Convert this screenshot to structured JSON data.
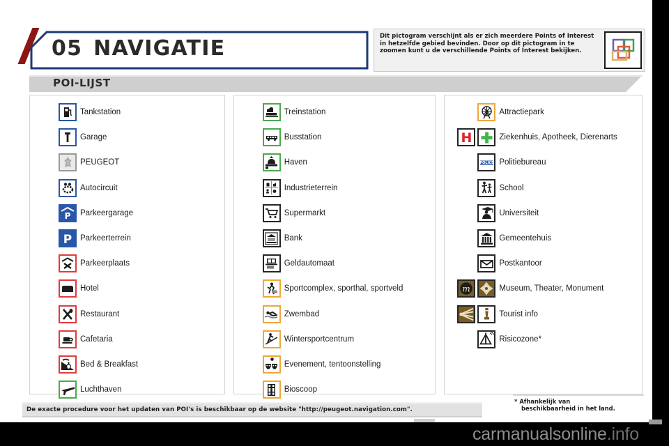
{
  "page": {
    "chapter_number": "05",
    "chapter_title": "NAVIGATIE",
    "section_label": "POI-LIJST",
    "watermark": "carmanualsonline",
    "watermark_suffix": ".info"
  },
  "note": {
    "text": "Dit pictogram verschijnt als er zich meerdere Points of Interest in hetzelfde gebied bevinden. Door op dit pictogram in te zoomen kunt u de verschillende Points of Interest bekijken.",
    "icon": "multiple-poi-icon"
  },
  "footer": {
    "update_note": "De exacte procedure voor het updaten van POI's is beschikbaar op de website \"http://peugeot.navigation.com\".",
    "footnote_marker": "*",
    "footnote_line1": "Afhankelijk van",
    "footnote_line2": "beschikbaarheid in het land."
  },
  "columns": [
    {
      "id": "column-1",
      "items": [
        {
          "label": "Tankstation",
          "icons": [
            "fuel-pump-icon"
          ],
          "border": "blue"
        },
        {
          "label": "Garage",
          "icons": [
            "wrench-icon"
          ],
          "border": "blue"
        },
        {
          "label": "PEUGEOT",
          "icons": [
            "peugeot-lion-icon"
          ],
          "border": "grey"
        },
        {
          "label": "Autocircuit",
          "icons": [
            "race-track-icon"
          ],
          "border": "blue"
        },
        {
          "label": "Parkeergarage",
          "icons": [
            "parking-garage-icon"
          ],
          "border": "blue"
        },
        {
          "label": "Parkeerterrein",
          "icons": [
            "parking-lot-icon"
          ],
          "border": "blue"
        },
        {
          "label": "Parkeerplaats",
          "icons": [
            "rest-area-icon"
          ],
          "border": "red"
        },
        {
          "label": "Hotel",
          "icons": [
            "bed-icon"
          ],
          "border": "red"
        },
        {
          "label": "Restaurant",
          "icons": [
            "cutlery-icon"
          ],
          "border": "red"
        },
        {
          "label": "Cafetaria",
          "icons": [
            "coffee-cup-icon"
          ],
          "border": "red"
        },
        {
          "label": "Bed & Breakfast",
          "icons": [
            "bed-breakfast-icon"
          ],
          "border": "red"
        },
        {
          "label": "Luchthaven",
          "icons": [
            "airplane-icon"
          ],
          "border": "green"
        }
      ]
    },
    {
      "id": "column-2",
      "items": [
        {
          "label": "Treinstation",
          "icons": [
            "train-icon"
          ],
          "border": "green"
        },
        {
          "label": "Busstation",
          "icons": [
            "bus-icon"
          ],
          "border": "green"
        },
        {
          "label": "Haven",
          "icons": [
            "harbour-icon"
          ],
          "border": "green"
        },
        {
          "label": "Industrieterrein",
          "icons": [
            "industry-grid-icon"
          ],
          "border": "dark"
        },
        {
          "label": "Supermarkt",
          "icons": [
            "shopping-cart-icon"
          ],
          "border": "dark"
        },
        {
          "label": "Bank",
          "icons": [
            "bank-building-icon"
          ],
          "border": "dark"
        },
        {
          "label": "Geldautomaat",
          "icons": [
            "atm-icon"
          ],
          "border": "dark"
        },
        {
          "label": "Sportcomplex, sporthal, sportveld",
          "icons": [
            "sports-icon"
          ],
          "border": "orange"
        },
        {
          "label": "Zwembad",
          "icons": [
            "swimmer-icon"
          ],
          "border": "orange"
        },
        {
          "label": "Wintersportcentrum",
          "icons": [
            "skier-icon"
          ],
          "border": "orange"
        },
        {
          "label": "Evenement, tentoonstelling",
          "icons": [
            "theatre-masks-icon"
          ],
          "border": "orange"
        },
        {
          "label": "Bioscoop",
          "icons": [
            "cinema-icon"
          ],
          "border": "orange"
        }
      ]
    },
    {
      "id": "column-3",
      "items": [
        {
          "label": "Attractiepark",
          "icons": [
            "ferris-wheel-icon"
          ],
          "border": "orange"
        },
        {
          "label": "Ziekenhuis, Apotheek, Dierenarts",
          "icons": [
            "hospital-h-icon",
            "green-cross-icon"
          ],
          "border": "dark"
        },
        {
          "label": "Politiebureau",
          "icons": [
            "police-icon"
          ],
          "border": "dark"
        },
        {
          "label": "School",
          "icons": [
            "school-children-icon"
          ],
          "border": "dark"
        },
        {
          "label": "Universiteit",
          "icons": [
            "graduate-icon"
          ],
          "border": "dark"
        },
        {
          "label": "Gemeentehuis",
          "icons": [
            "town-hall-icon"
          ],
          "border": "dark"
        },
        {
          "label": "Postkantoor",
          "icons": [
            "envelope-icon"
          ],
          "border": "dark"
        },
        {
          "label": "Museum, Theater, Monument",
          "icons": [
            "museum-m-icon",
            "monument-icon"
          ],
          "border": "dark"
        },
        {
          "label": "Tourist info",
          "icons": [
            "sunburst-icon",
            "info-i-icon"
          ],
          "border": "dark"
        },
        {
          "label": "Risicozone*",
          "icons": [
            "warning-triangle-icon"
          ],
          "border": "dark"
        }
      ]
    }
  ],
  "colors": {
    "blue": "#2a56a8",
    "green": "#4aab4a",
    "red": "#e03b3b",
    "orange": "#eda83a",
    "grey": "#9a9a9a",
    "dark": "#262626",
    "accent_red": "#8c1616",
    "banner_blue": "#1b3a74"
  }
}
